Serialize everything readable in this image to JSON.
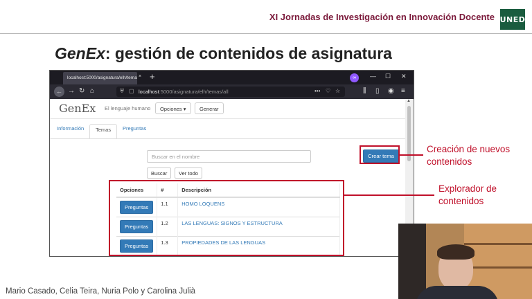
{
  "slide": {
    "conference": "XI Jornadas de Investigación en Innovación Docente",
    "logo": "UNED",
    "title_em": "GenEx",
    "title_rest": ": gestión de contenidos de asignatura",
    "authors": "Mario Casado, Celia Teira, Nuria Polo y Carolina Julià"
  },
  "browser": {
    "tab_title": "localhost:5000/asignatura/elh/temas",
    "tab_close": "×",
    "new_tab": "+",
    "extension": "∞",
    "url_host": "localhost",
    "url_path": ":5000/asignatura/elh/temas/all",
    "icons": [
      "back-icon",
      "forward-icon",
      "reload-icon",
      "home-icon",
      "shield-icon",
      "page-icon",
      "more-icon",
      "pocket-icon",
      "star-icon",
      "library-icon",
      "sidebar-icon",
      "account-icon",
      "menu-icon"
    ]
  },
  "app": {
    "brand": "GenEx",
    "tagline": "El lenguaje humano",
    "options_label": "Opciones ▾",
    "generate_label": "Generar",
    "tabs": [
      {
        "label": "Información",
        "active": false
      },
      {
        "label": "Temas",
        "active": true
      },
      {
        "label": "Preguntas",
        "active": false
      }
    ],
    "search_placeholder": "Buscar en el nombre",
    "create_label": "Crear tema",
    "search_button": "Buscar",
    "view_all": "Ver todo",
    "table": {
      "headers": [
        "Opciones",
        "#",
        "Descripción"
      ],
      "rows": [
        {
          "button": "Preguntas",
          "num": "1.1",
          "desc": "HOMO LOQUENS"
        },
        {
          "button": "Preguntas",
          "num": "1.2",
          "desc": "LAS LENGUAS: SIGNOS Y ESTRUCTURA"
        },
        {
          "button": "Preguntas",
          "num": "1.3",
          "desc": "PROPIEDADES DE LAS LENGUAS"
        }
      ]
    }
  },
  "annotations": {
    "create": "Creación de nuevos contenidos",
    "explorer": "Explorador de contenidos",
    "color": "#c0102a"
  }
}
